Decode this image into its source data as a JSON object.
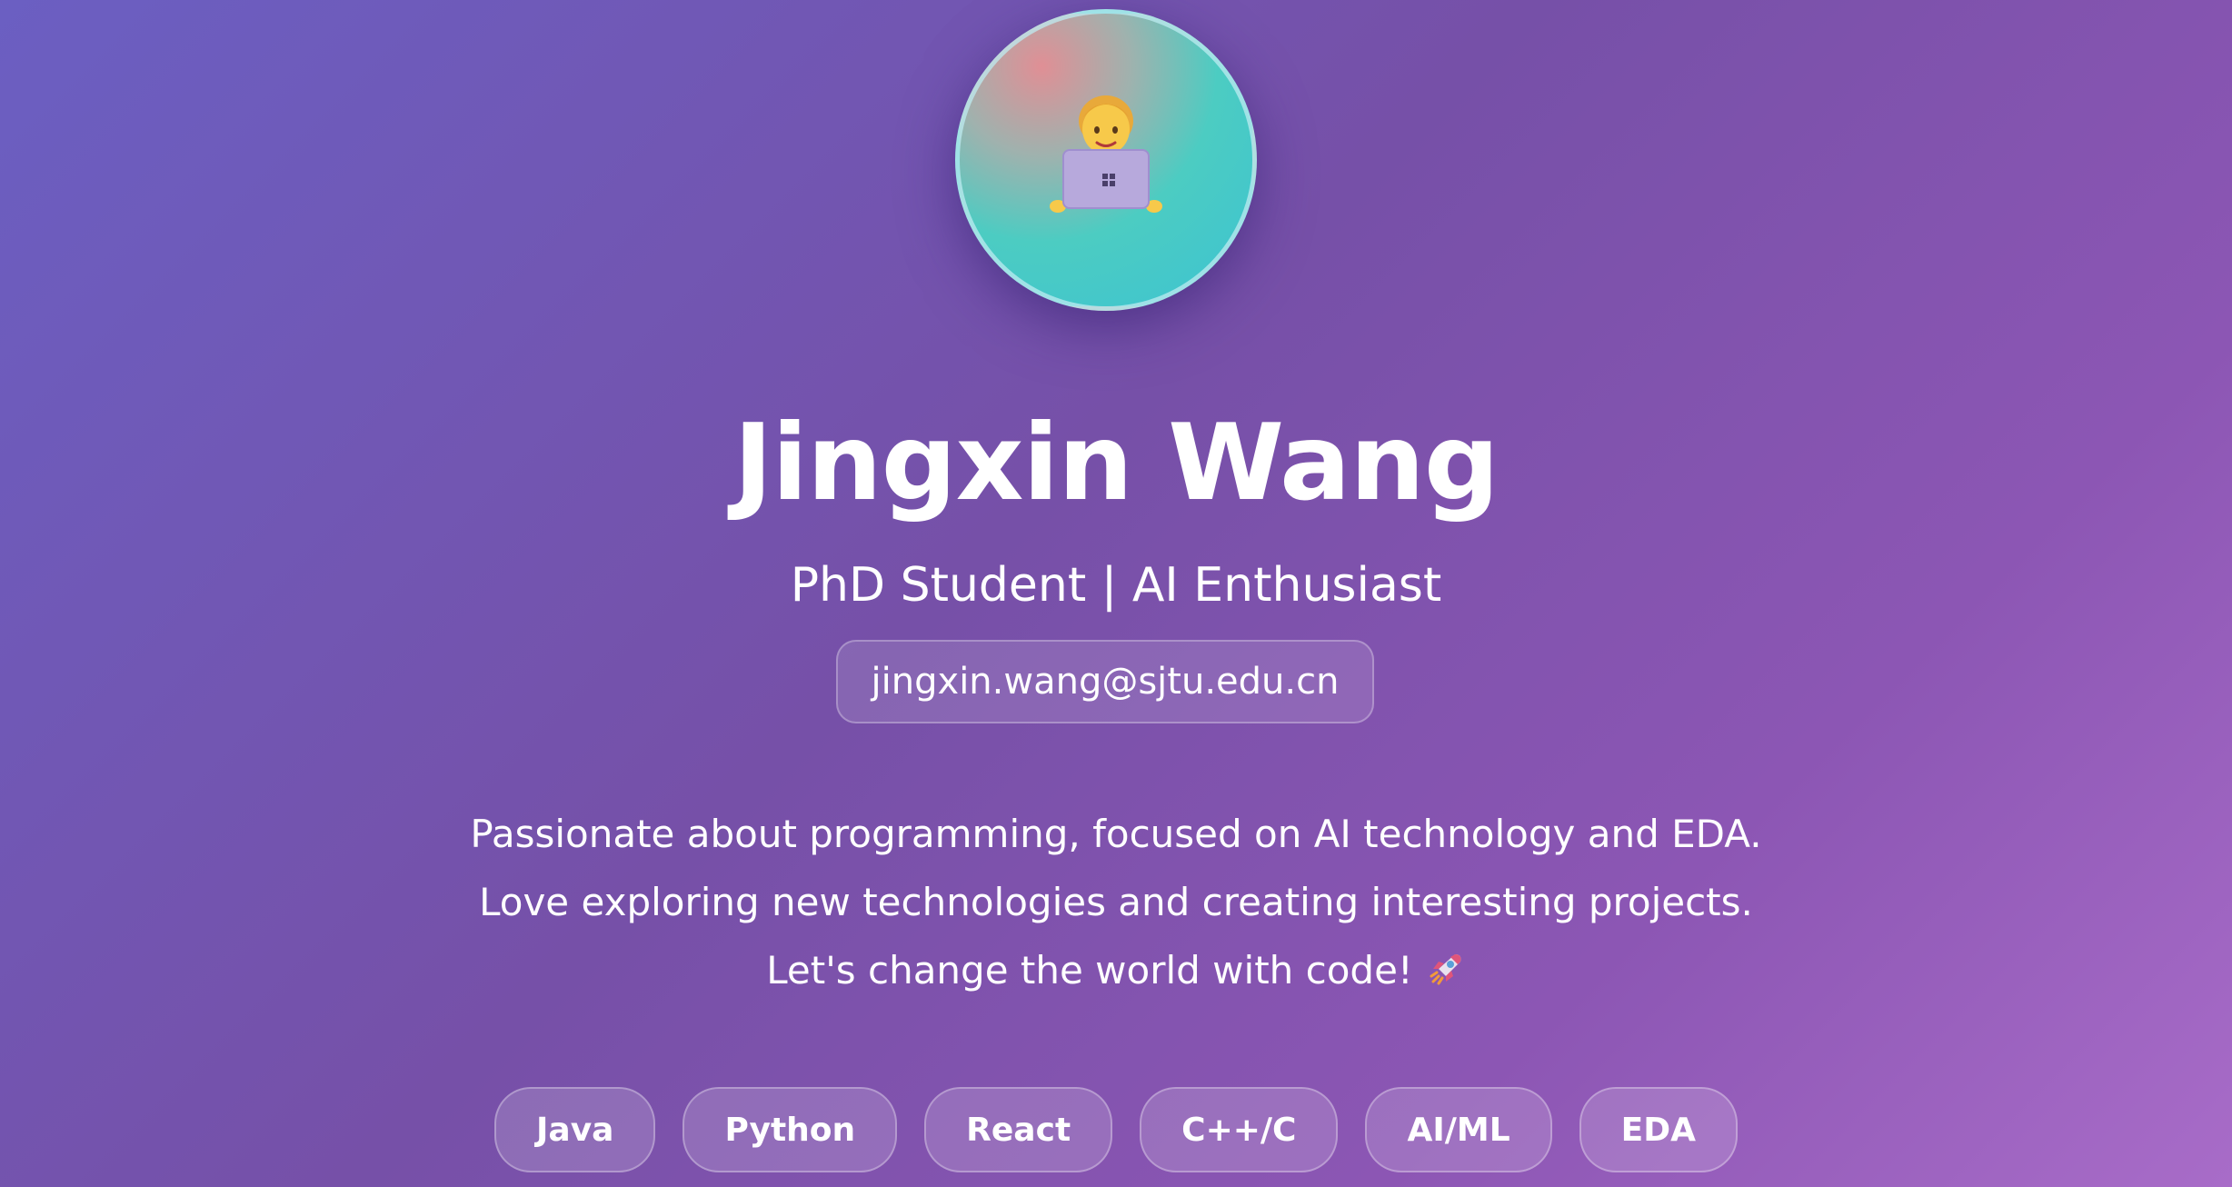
{
  "profile": {
    "avatar_icon": "technologist-with-laptop-icon",
    "name": "Jingxin Wang",
    "subtitle": "PhD Student | AI Enthusiast",
    "email": "jingxin.wang@sjtu.edu.cn",
    "bio": [
      "Passionate about programming, focused on AI technology and EDA.",
      "Love exploring new technologies and creating interesting projects.",
      "Let's change the world with code!"
    ],
    "bio_trailing_icon": "rocket-icon"
  },
  "skills": [
    "Java",
    "Python",
    "React",
    "C++/C",
    "AI/ML",
    "EDA"
  ],
  "colors": {
    "background_start": "#6b5fc2",
    "background_end": "#a86cc8",
    "avatar_gradient": "#3cc3d2",
    "text": "#ffffff"
  }
}
